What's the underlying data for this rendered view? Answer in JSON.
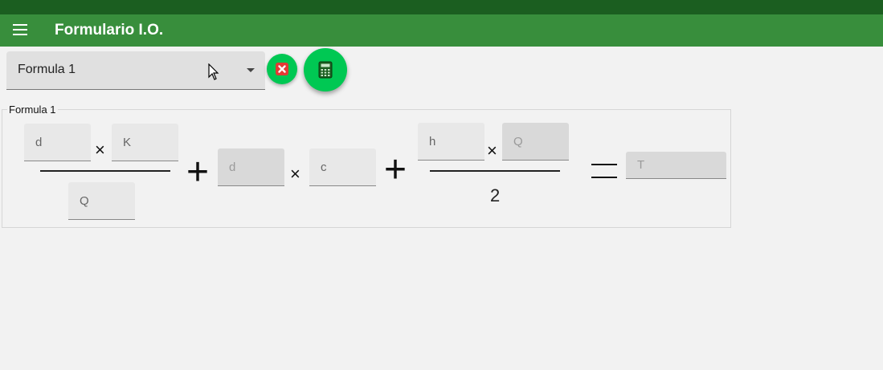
{
  "app": {
    "title": "Formulario I.O."
  },
  "formula_select": {
    "value": "Formula 1"
  },
  "section": {
    "legend": "Formula 1"
  },
  "fields": {
    "d1": "d",
    "k": "K",
    "q1": "Q",
    "d2": "d",
    "c": "c",
    "h": "h",
    "q2": "Q",
    "t": "T"
  },
  "operators": {
    "times": "×",
    "plus": "+",
    "two": "2"
  },
  "icons": {
    "menu": "menu-icon",
    "clear": "close-icon",
    "calc": "calculator-icon"
  },
  "colors": {
    "statusbar": "#1b5e20",
    "appbar": "#388e3c",
    "fab": "#00c853",
    "clear": "#e53935"
  }
}
